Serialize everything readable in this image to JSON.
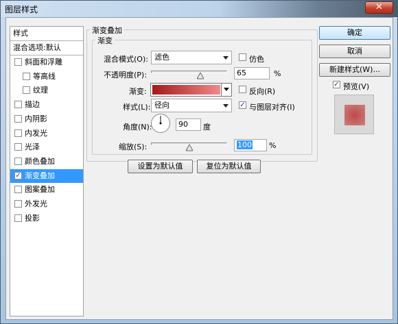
{
  "window": {
    "title": "图层样式",
    "close_glyph": "✕"
  },
  "stylelist": {
    "header": "样式",
    "blend_options": "混合选项:默认",
    "items": [
      {
        "label": "斜面和浮雕",
        "checked": false,
        "indent": false
      },
      {
        "label": "等高线",
        "checked": false,
        "indent": true
      },
      {
        "label": "纹理",
        "checked": false,
        "indent": true
      },
      {
        "label": "描边",
        "checked": false,
        "indent": false
      },
      {
        "label": "内阴影",
        "checked": false,
        "indent": false
      },
      {
        "label": "内发光",
        "checked": false,
        "indent": false
      },
      {
        "label": "光泽",
        "checked": false,
        "indent": false
      },
      {
        "label": "颜色叠加",
        "checked": false,
        "indent": false
      },
      {
        "label": "渐变叠加",
        "checked": true,
        "indent": false,
        "selected": true
      },
      {
        "label": "图案叠加",
        "checked": false,
        "indent": false
      },
      {
        "label": "外发光",
        "checked": false,
        "indent": false
      },
      {
        "label": "投影",
        "checked": false,
        "indent": false
      }
    ]
  },
  "panel": {
    "outer_title": "渐变叠加",
    "inner_title": "渐变",
    "blend_mode": {
      "label": "混合模式(O):",
      "value": "滤色"
    },
    "dither": {
      "label": "仿色",
      "checked": false
    },
    "opacity": {
      "label": "不透明度(P):",
      "value": "65",
      "unit": "%",
      "fraction": 0.65
    },
    "gradient": {
      "label": "渐变:",
      "start_color": "#a51818",
      "end_color": "#f08a8a"
    },
    "reverse": {
      "label": "反向(R)",
      "checked": false
    },
    "style": {
      "label": "样式(L):",
      "value": "径向"
    },
    "align": {
      "label": "与图层对齐(I)",
      "checked": true
    },
    "angle": {
      "label": "角度(N):",
      "value": "90",
      "unit": "度"
    },
    "scale": {
      "label": "缩放(S):",
      "value": "100",
      "unit": "%",
      "fraction": 0.5
    },
    "make_default": "设置为默认值",
    "reset_default": "复位为默认值"
  },
  "buttons": {
    "ok": "确定",
    "cancel": "取消",
    "new_style": "新建样式(W)...",
    "preview": {
      "label": "预览(V)",
      "checked": true
    }
  },
  "preview": {
    "bg_color": "#d9d9d9",
    "swatch_center": "#c04a4a",
    "swatch_edge": "#c98080"
  },
  "check_glyph": "✓"
}
